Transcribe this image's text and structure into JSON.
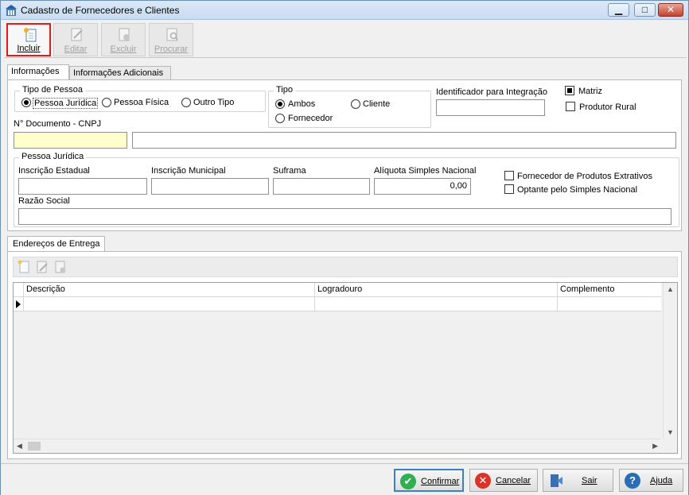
{
  "window": {
    "title": "Cadastro de Fornecedores e Clientes",
    "min_glyph": "▁",
    "max_glyph": "□",
    "close_glyph": "✕"
  },
  "toolbar": {
    "incluir": "Incluir",
    "editar": "Editar",
    "excluir": "Excluir",
    "procurar": "Procurar"
  },
  "tabs": {
    "informacoes": "Informações",
    "informacoes_adicionais": "Informações Adicionais"
  },
  "tipo_pessoa": {
    "title": "Tipo de Pessoa",
    "juridica": "Pessoa Jurídica",
    "fisica": "Pessoa Física",
    "outro": "Outro Tipo",
    "selected": "Pessoa Jurídica"
  },
  "tipo": {
    "title": "Tipo",
    "ambos": "Ambos",
    "cliente": "Cliente",
    "fornecedor": "Fornecedor",
    "selected": "Ambos"
  },
  "identificador": {
    "label": "Identificador para Integração",
    "value": ""
  },
  "matriz": {
    "label": "Matriz",
    "checked": true
  },
  "produtor_rural": {
    "label": "Produtor Rural",
    "checked": false
  },
  "documento": {
    "label": "N° Documento - CNPJ",
    "value": "",
    "name_value": ""
  },
  "pessoa_juridica": {
    "title": "Pessoa Jurídica",
    "inscricao_estadual": "Inscrição Estadual",
    "inscricao_municipal": "Inscrição Municipal",
    "suframa": "Suframa",
    "aliquota": "Alíquota Simples Nacional",
    "aliquota_value": "0,00",
    "fornecedor_extrativos": "Fornecedor de Produtos Extrativos",
    "optante_simples": "Optante pelo Simples Nacional",
    "razao_social": "Razão Social"
  },
  "enderecos": {
    "tab": "Endereços de Entrega",
    "columns": [
      "Descrição",
      "Logradouro",
      "Complemento"
    ]
  },
  "footer": {
    "confirmar": "Confirmar",
    "cancelar": "Cancelar",
    "sair": "Sair",
    "ajuda": "Ajuda"
  },
  "colors": {
    "accent_red": "#e01b1b",
    "confirm_green": "#2fae52",
    "cancel_red": "#d9342b",
    "help_blue": "#2b6db4"
  }
}
